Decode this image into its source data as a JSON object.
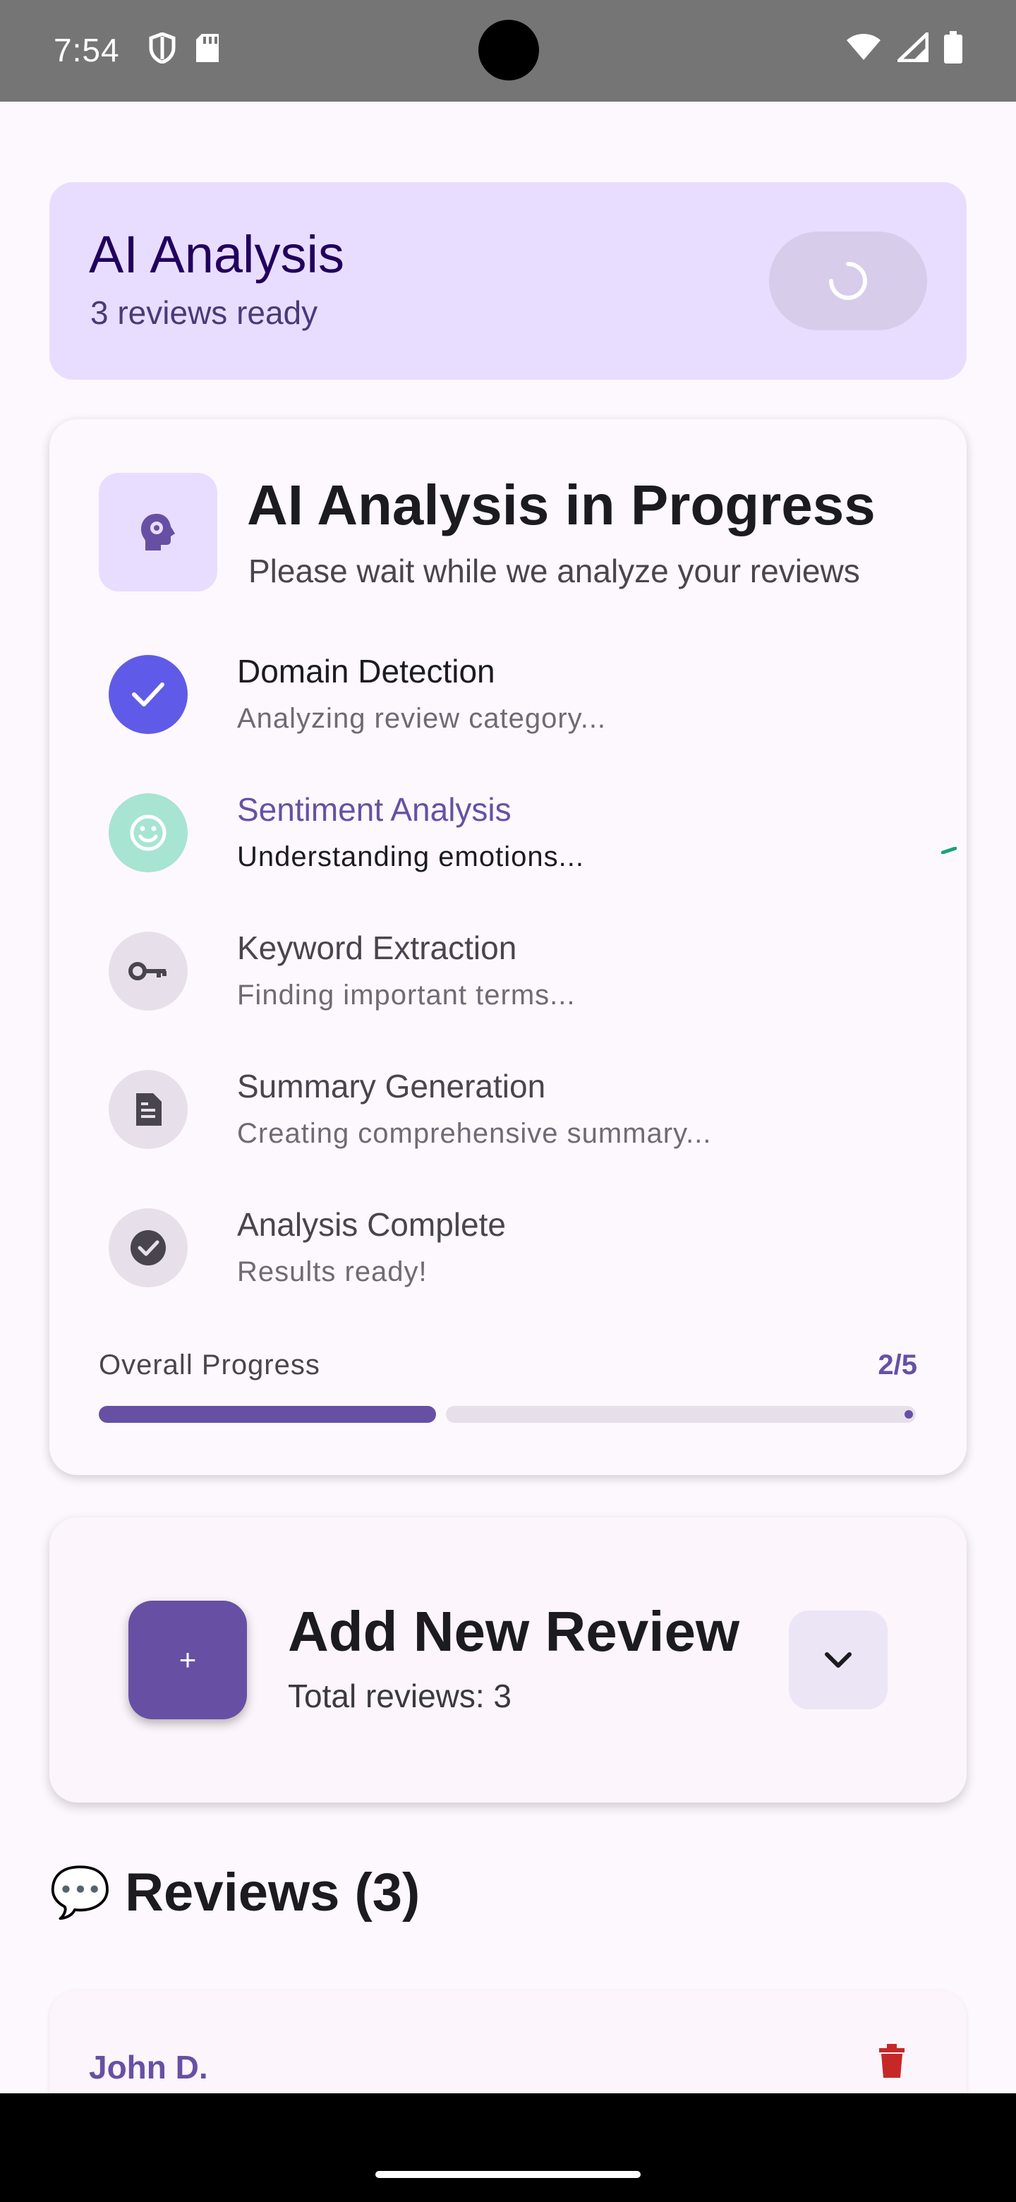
{
  "status_bar": {
    "time": "7:54"
  },
  "header": {
    "title": "AI Analysis",
    "subtitle": "3 reviews ready"
  },
  "progress": {
    "title": "AI Analysis in Progress",
    "subtitle": "Please wait while we analyze your reviews",
    "steps": [
      {
        "title": "Domain Detection",
        "desc": "Analyzing review category...",
        "state": "done"
      },
      {
        "title": "Sentiment Analysis",
        "desc": "Understanding emotions...",
        "state": "active"
      },
      {
        "title": "Keyword Extraction",
        "desc": "Finding important terms...",
        "state": "pending"
      },
      {
        "title": "Summary Generation",
        "desc": "Creating comprehensive summary...",
        "state": "pending"
      },
      {
        "title": "Analysis Complete",
        "desc": "Results ready!",
        "state": "pending"
      }
    ],
    "overall_label": "Overall Progress",
    "overall_value": "2/5",
    "overall_fraction": 0.4
  },
  "add_review": {
    "fab_label": "+",
    "title": "Add New Review",
    "subtitle": "Total reviews: 3"
  },
  "reviews": {
    "emoji": "💬",
    "title": "Reviews (3)",
    "items": [
      {
        "author": "John D."
      }
    ]
  },
  "colors": {
    "primary": "#6750A4",
    "active_step": "#A8E4D2",
    "done_step": "#5F5BE8",
    "delete": "#C62828",
    "header_bg": "#E9DDFF"
  },
  "icons": {
    "status_left": [
      "shield-icon",
      "sd-card-icon"
    ],
    "status_right": [
      "wifi-icon",
      "signal-icon",
      "battery-icon"
    ],
    "steps": [
      "check-icon",
      "smile-icon",
      "key-icon",
      "document-icon",
      "check-circle-icon"
    ]
  }
}
